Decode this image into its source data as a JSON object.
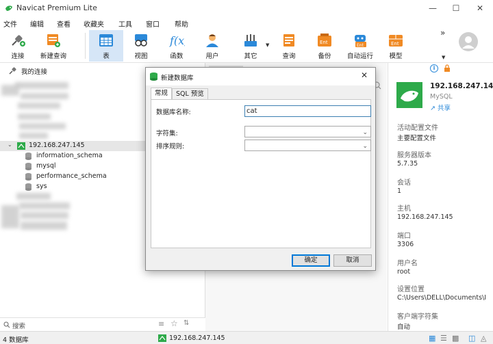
{
  "window": {
    "title": "Navicat Premium Lite",
    "controls": [
      "minimize",
      "maximize",
      "close"
    ]
  },
  "menu": [
    "文件",
    "编辑",
    "查看",
    "收藏夹",
    "工具",
    "窗口",
    "帮助"
  ],
  "toolbar": {
    "items": [
      {
        "label": "连接",
        "icon": "plug-icon"
      },
      {
        "label": "新建查询",
        "icon": "new-query-icon"
      },
      {
        "label": "表",
        "icon": "table-icon",
        "active": true
      },
      {
        "label": "视图",
        "icon": "view-icon"
      },
      {
        "label": "函数",
        "icon": "function-icon"
      },
      {
        "label": "用户",
        "icon": "user-icon"
      },
      {
        "label": "其它",
        "icon": "tools-icon"
      },
      {
        "label": "查询",
        "icon": "query-icon"
      },
      {
        "label": "备份",
        "icon": "backup-icon"
      },
      {
        "label": "自动运行",
        "icon": "robot-icon"
      },
      {
        "label": "模型",
        "icon": "model-icon"
      }
    ],
    "overflow": "»"
  },
  "left_panel": {
    "header": "我的连接",
    "selected_connection": "192.168.247.145",
    "databases": [
      "information_schema",
      "mysql",
      "performance_schema",
      "sys"
    ],
    "search_placeholder": "搜索"
  },
  "right_panel": {
    "host_title": "192.168.247.14",
    "db_type": "MySQL",
    "share": "共享",
    "fields": [
      {
        "label": "活动配置文件",
        "value": "主要配置文件"
      },
      {
        "label": "服务器版本",
        "value": "5.7.35"
      },
      {
        "label": "会话",
        "value": "1"
      },
      {
        "label": "主机",
        "value": "192.168.247.145"
      },
      {
        "label": "端口",
        "value": "3306"
      },
      {
        "label": "用户名",
        "value": "root"
      },
      {
        "label": "设置位置",
        "value": "C:\\Users\\DELL\\Documents\\I"
      },
      {
        "label": "客户端字符集",
        "value": "自动"
      }
    ]
  },
  "status_bar": {
    "left": "4 数据库",
    "connection": "192.168.247.145"
  },
  "dialog": {
    "title": "新建数据库",
    "tabs": [
      "常规",
      "SQL 预览"
    ],
    "active_tab": 0,
    "db_name_label": "数据库名称:",
    "db_name_value": "cat",
    "charset_label": "字符集:",
    "charset_value": "",
    "collation_label": "排序规则:",
    "collation_value": "",
    "ok": "确定",
    "cancel": "取消"
  },
  "colors": {
    "accent": "#0078d7",
    "active_tool_bg": "#d6e6f7",
    "db_icon_green": "#2eaa4a"
  }
}
